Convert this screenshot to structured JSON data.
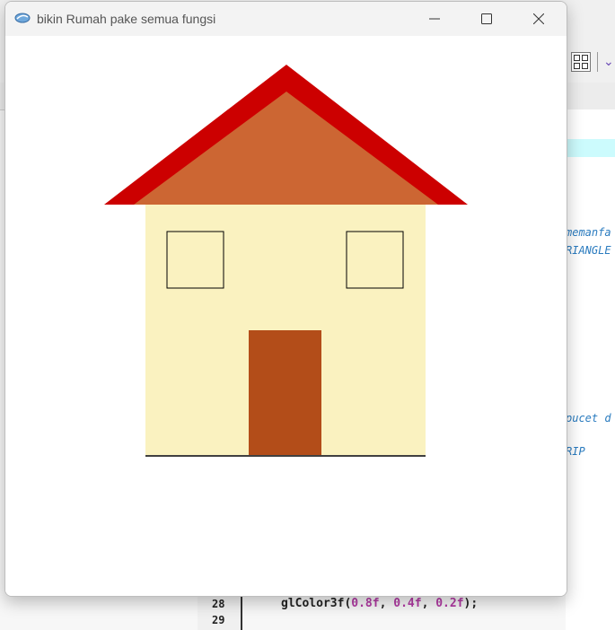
{
  "window": {
    "title": "bikin Rumah pake semua fungsi"
  },
  "background_editor": {
    "code_fragments": [
      "memanfa",
      "RIANGLE",
      "pucet d",
      "RIP"
    ],
    "line_numbers": [
      "28",
      "29"
    ],
    "code_line": {
      "prefix": "glColor3f(",
      "arg1": "0.8f",
      "arg2": "0.4f",
      "arg3": "0.2f",
      "suffix": ");"
    }
  },
  "scene": {
    "roof_outer_color": "#cc0000",
    "roof_inner_color": "#cc6633",
    "wall_color": "#faf2c0",
    "door_color": "#b34d19",
    "window_color": "#faf2c0",
    "outline_color": "#000000"
  }
}
